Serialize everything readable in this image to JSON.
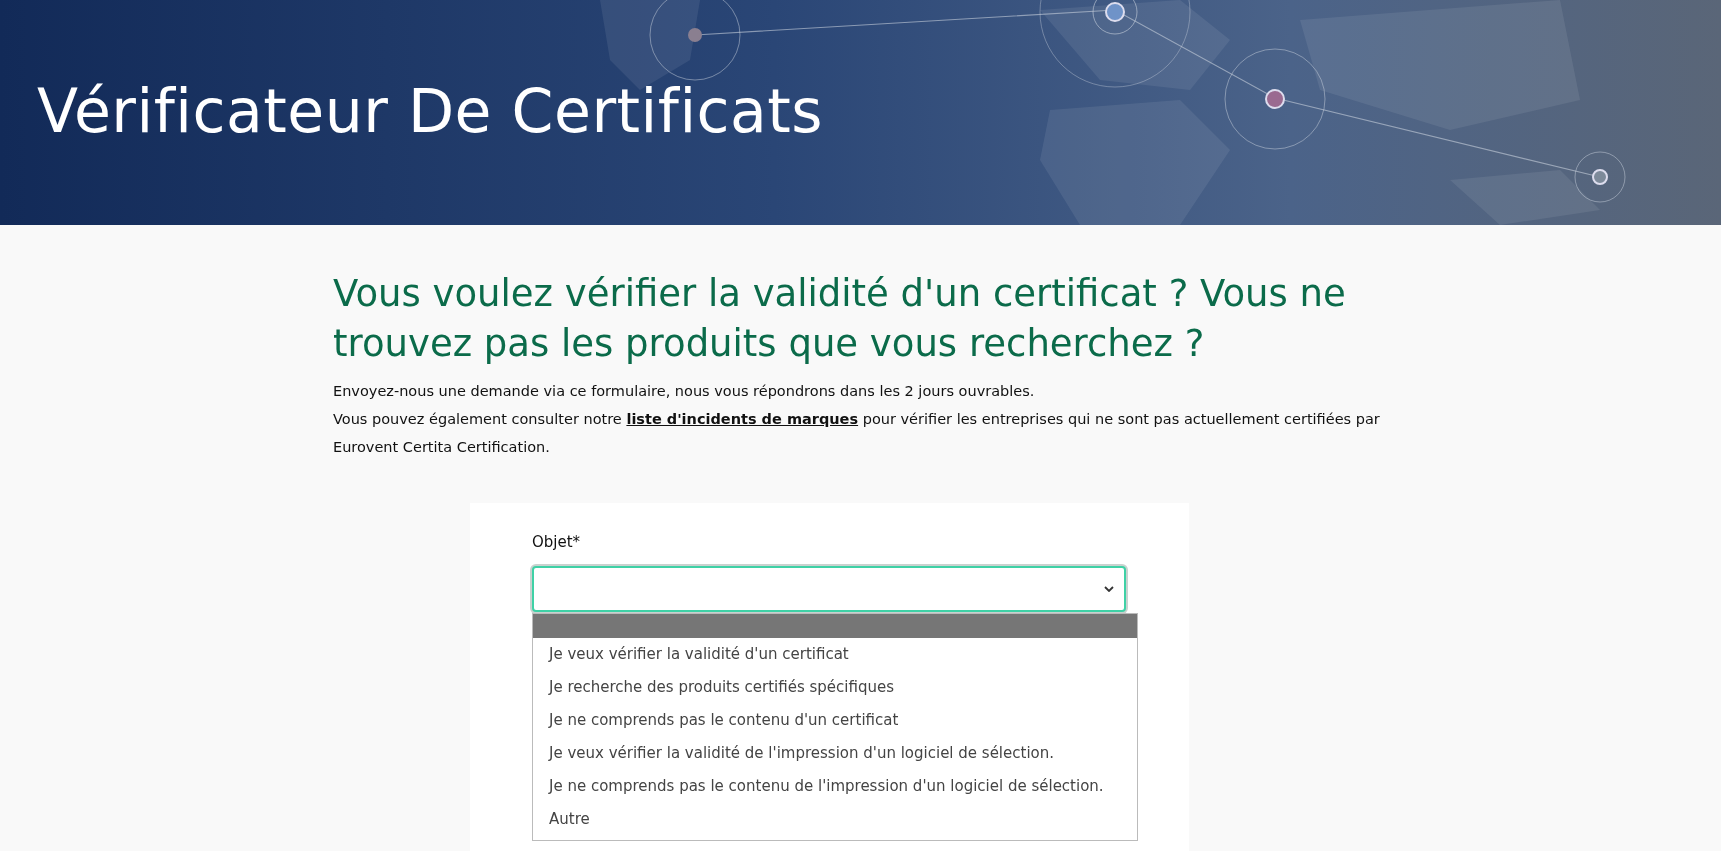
{
  "banner": {
    "title": "Vérificateur De Certificats"
  },
  "intro": {
    "heading": "Vous voulez vérifier la validité d'un certificat ? Vous ne trouvez pas les produits que vous recherchez ?",
    "line_1": "Envoyez-nous une demande via ce formulaire, nous vous répondrons dans les 2 jours ouvrables.",
    "line_2_before": "Vous pouvez également consulter notre",
    "line_2_link": "liste d'incidents de marques",
    "line_2_after": "pour vérifier les entreprises qui ne sont pas actuellement certifiées par Eurovent Certita Certification."
  },
  "form": {
    "subject_label": "Objet*",
    "subject_focused": true,
    "subject_dropdown": {
      "blank_option": {
        "selected": true
      },
      "options": [
        {
          "label": "Je veux vérifier la validité d'un certificat",
          "selected": false
        },
        {
          "label": "Je recherche des produits certifiés spécifiques",
          "selected": false
        },
        {
          "label": "Je ne comprends pas le contenu d'un certificat",
          "selected": false
        },
        {
          "label": "Je veux vérifier la validité de l'impression d'un logiciel de sélection.",
          "selected": false
        },
        {
          "label": "Je ne comprends pas le contenu de l'impression d'un logiciel de sélection.",
          "selected": false
        },
        {
          "label": "Autre",
          "selected": false
        }
      ]
    }
  }
}
